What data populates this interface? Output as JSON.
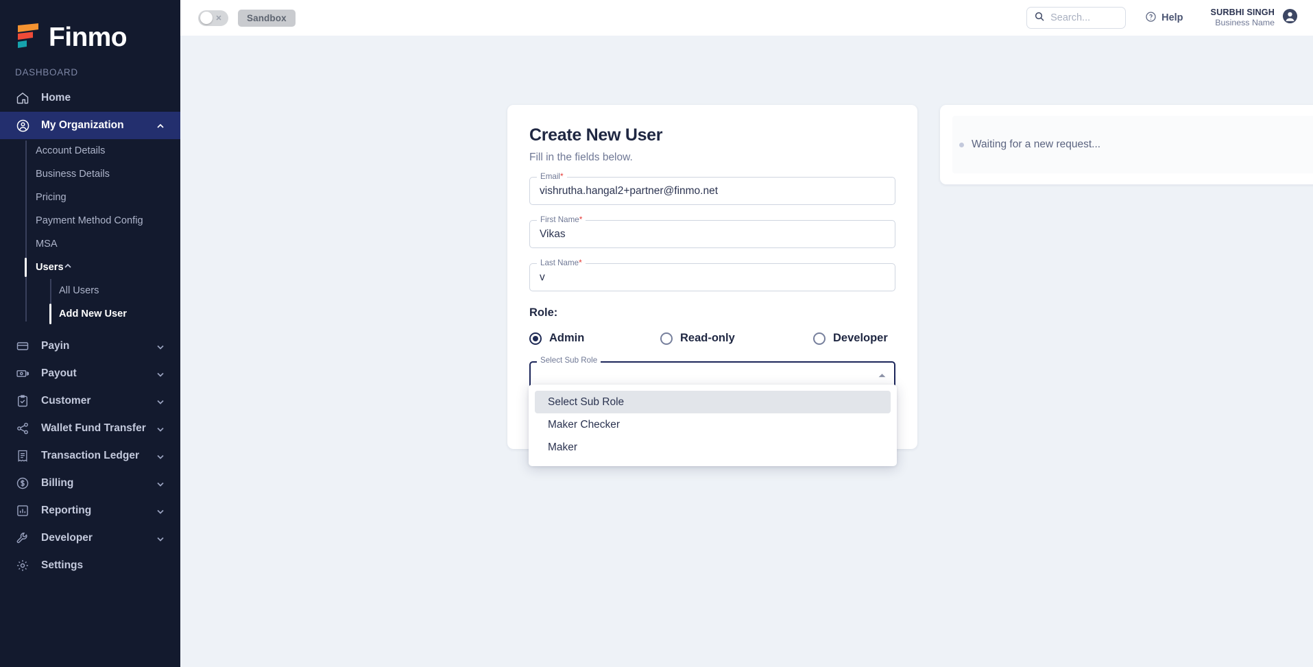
{
  "brand": {
    "name": "Finmo",
    "logo_icon": "finmo-logo",
    "colors": {
      "orange": "#f59331",
      "red": "#ef4b38",
      "teal": "#16a3ad",
      "sidebar_bg": "#131a2e",
      "active_nav": "#232f6e"
    }
  },
  "sidebar": {
    "section_label": "DASHBOARD",
    "items": [
      {
        "label": "Home",
        "icon": "home-icon",
        "expandable": false,
        "active": false
      },
      {
        "label": "My Organization",
        "icon": "user-circle-icon",
        "expandable": true,
        "expanded": true,
        "active": true
      },
      {
        "label": "Payin",
        "icon": "credit-card-icon",
        "expandable": true,
        "expanded": false,
        "active": false
      },
      {
        "label": "Payout",
        "icon": "banknote-icon",
        "expandable": true,
        "expanded": false,
        "active": false
      },
      {
        "label": "Customer",
        "icon": "clipboard-check-icon",
        "expandable": true,
        "expanded": false,
        "active": false
      },
      {
        "label": "Wallet Fund Transfer",
        "icon": "share-icon",
        "expandable": true,
        "expanded": false,
        "active": false
      },
      {
        "label": "Transaction Ledger",
        "icon": "receipt-icon",
        "expandable": true,
        "expanded": false,
        "active": false
      },
      {
        "label": "Billing",
        "icon": "dollar-circle-icon",
        "expandable": true,
        "expanded": false,
        "active": false
      },
      {
        "label": "Reporting",
        "icon": "bar-chart-icon",
        "expandable": true,
        "expanded": false,
        "active": false
      },
      {
        "label": "Developer",
        "icon": "wrench-icon",
        "expandable": true,
        "expanded": false,
        "active": false
      },
      {
        "label": "Settings",
        "icon": "gear-icon",
        "expandable": false,
        "active": false
      }
    ],
    "org_subitems": [
      {
        "label": "Account Details",
        "active": false
      },
      {
        "label": "Business Details",
        "active": false
      },
      {
        "label": "Pricing",
        "active": false
      },
      {
        "label": "Payment Method Config",
        "active": false
      },
      {
        "label": "MSA",
        "active": false
      },
      {
        "label": "Users",
        "active": true
      }
    ],
    "users_subitems": [
      {
        "label": "All Users",
        "active": false
      },
      {
        "label": "Add New User",
        "active": true
      }
    ]
  },
  "header": {
    "env_toggle": {
      "state": "off",
      "icon": "close-x-icon"
    },
    "env_badge": "Sandbox",
    "search": {
      "placeholder": "Search...",
      "value": "",
      "icon": "search-icon"
    },
    "help": {
      "label": "Help",
      "icon": "question-circle-icon"
    },
    "user": {
      "name": "SURBHI SINGH",
      "business": "Business Name",
      "avatar_icon": "avatar-icon"
    }
  },
  "form": {
    "title": "Create New User",
    "subtitle": "Fill in the fields below.",
    "fields": [
      {
        "label": "Email",
        "required": true,
        "value": "vishrutha.hangal2+partner@finmo.net"
      },
      {
        "label": "First Name",
        "required": true,
        "value": "Vikas"
      },
      {
        "label": "Last Name",
        "required": true,
        "value": "v"
      }
    ],
    "role": {
      "label": "Role:",
      "options": [
        {
          "label": "Admin",
          "selected": true
        },
        {
          "label": "Read-only",
          "selected": false
        },
        {
          "label": "Developer",
          "selected": false
        }
      ]
    },
    "sub_role": {
      "label": "Select Sub Role",
      "value": "",
      "open": true,
      "arrow_icon": "chevron-up-icon",
      "options": [
        {
          "label": "Select Sub Role",
          "highlighted": true
        },
        {
          "label": "Maker Checker",
          "highlighted": false
        },
        {
          "label": "Maker",
          "highlighted": false
        }
      ]
    }
  },
  "status_panel": {
    "text": "Waiting for a new request...",
    "dot_icon": "status-dot-icon"
  }
}
